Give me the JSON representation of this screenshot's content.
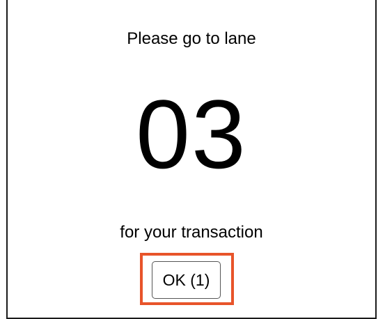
{
  "dialog": {
    "prompt_top": "Please go to lane",
    "lane_number": "03",
    "prompt_bottom": "for your transaction",
    "ok_button_label": "OK (1)"
  },
  "colors": {
    "highlight": "#e8542a",
    "border": "#1a1a1a",
    "background": "#ffffff"
  }
}
